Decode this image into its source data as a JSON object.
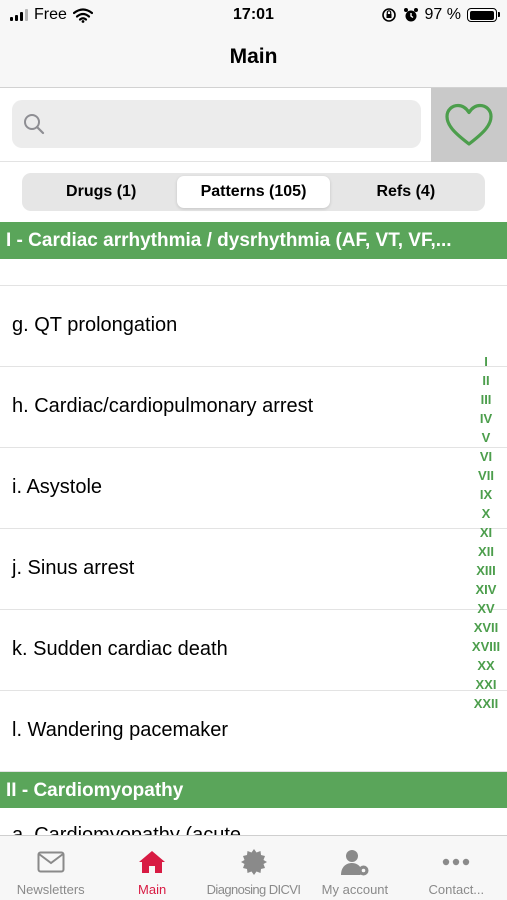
{
  "status_bar": {
    "carrier": "Free",
    "time": "17:01",
    "battery_percent": "97 %",
    "battery_level": 0.97
  },
  "nav": {
    "title": "Main"
  },
  "search": {
    "placeholder": "",
    "value": ""
  },
  "segments": [
    {
      "label": "Drugs (1)",
      "active": false
    },
    {
      "label": "Patterns (105)",
      "active": true
    },
    {
      "label": "Refs (4)",
      "active": false
    }
  ],
  "sections": [
    {
      "title": "I - Cardiac arrhythmia / dysrhythmia (AF, VT, VF,..."
    },
    {
      "title": "II - Cardiomyopathy"
    }
  ],
  "rows": [
    {
      "label": "g. QT prolongation"
    },
    {
      "label": "h. Cardiac/cardiopulmonary arrest"
    },
    {
      "label": "i. Asystole"
    },
    {
      "label": "j. Sinus arrest"
    },
    {
      "label": "k. Sudden cardiac death"
    },
    {
      "label": "l. Wandering pacemaker"
    }
  ],
  "partial_row": {
    "label": "a. Cardiomyopathy (acute..."
  },
  "index": [
    "I",
    "II",
    "III",
    "IV",
    "V",
    "VI",
    "VII",
    "IX",
    "X",
    "XI",
    "XII",
    "XIII",
    "XIV",
    "XV",
    "XVII",
    "XVIII",
    "XX",
    "XXI",
    "XXII"
  ],
  "tabs": [
    {
      "label": "Newsletters",
      "icon": "envelope-icon",
      "active": false
    },
    {
      "label": "Main",
      "icon": "home-icon",
      "active": true
    },
    {
      "label": "Diagnosing DICVI",
      "icon": "badge-icon",
      "active": false
    },
    {
      "label": "My account",
      "icon": "user-settings-icon",
      "active": false
    },
    {
      "label": "Contact...",
      "icon": "more-dots-icon",
      "active": false
    }
  ],
  "colors": {
    "accent_green": "#5aa55a",
    "index_green": "#4c9e4c",
    "active_tab": "#d81b43",
    "inactive_tab": "#8a8a8a"
  }
}
